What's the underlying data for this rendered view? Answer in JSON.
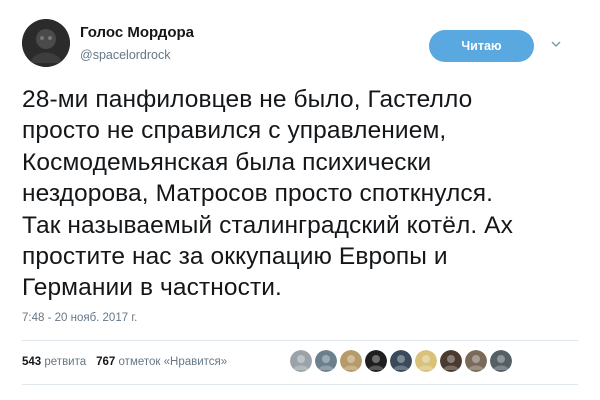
{
  "author": {
    "display_name": "Голос Мордора",
    "handle": "@spacelordrock"
  },
  "follow_button_label": "Читаю",
  "tweet": {
    "lines": [
      "28-ми панфиловцев не было, Гастелло",
      "просто не справился с управлением,",
      "Космодемьянская была психически",
      "нездорова, Матросов просто споткнулся.",
      "Так называемый сталинградский котёл. Ах",
      "простите нас за оккупацию Европы и",
      "Германии в частности."
    ],
    "timestamp": "7:48 - 20 нояб. 2017 г."
  },
  "stats": {
    "retweets_count": "543",
    "retweets_label": "ретвита",
    "likes_count": "767",
    "likes_label": "отметок «Нравится»"
  },
  "likers": [
    {
      "icon": "avatar-icon",
      "color": "#9aa3a8"
    },
    {
      "icon": "avatar-icon",
      "color": "#6b7f8c"
    },
    {
      "icon": "avatar-icon",
      "color": "#b59a6a"
    },
    {
      "icon": "avatar-icon",
      "color": "#1f1f1f"
    },
    {
      "icon": "avatar-icon",
      "color": "#3a4a5a"
    },
    {
      "icon": "avatar-icon",
      "color": "#d8c27a"
    },
    {
      "icon": "avatar-icon",
      "color": "#4a3a30"
    },
    {
      "icon": "avatar-icon",
      "color": "#7a6a5a"
    },
    {
      "icon": "avatar-icon",
      "color": "#555f66"
    }
  ],
  "colors": {
    "accent": "#5aa8e0",
    "text": "#14171a",
    "muted": "#657786",
    "divider": "#e1e8ed"
  }
}
